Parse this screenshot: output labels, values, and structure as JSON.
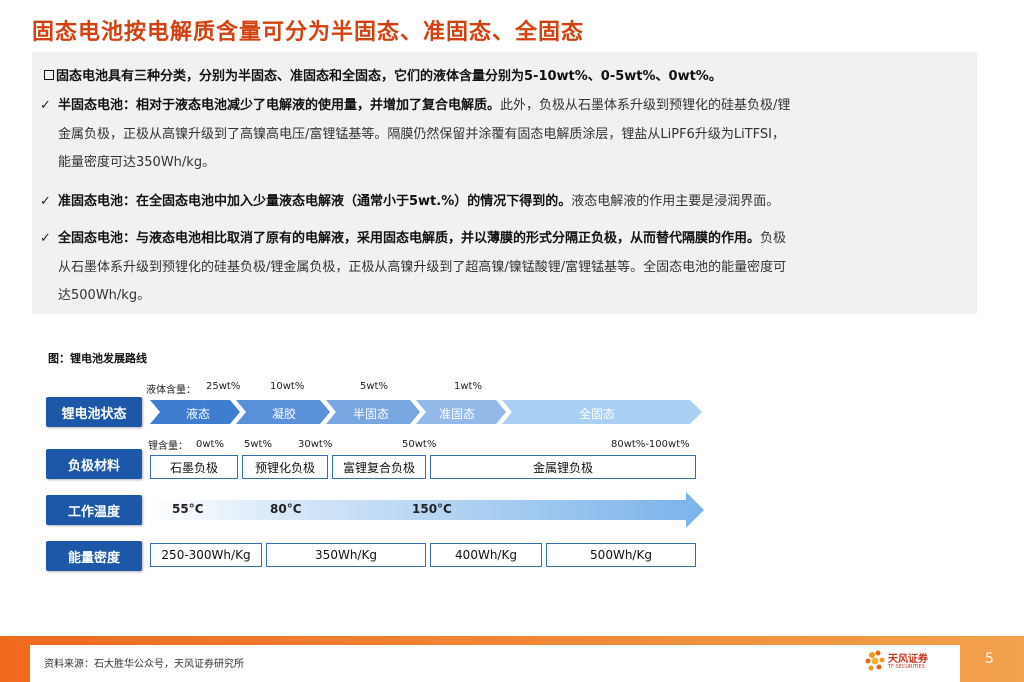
{
  "title": "固态电池按电解质含量可分为半固态、准固态、全固态",
  "summary": {
    "head": "固态电池具有三种分类，分别为半固态、准固态和全固态，它们的液体含量分别为5-10wt%、0-5wt%、0wt%。",
    "items": [
      {
        "check": "✓",
        "bold": "半固态电池：相对于液态电池减少了电解液的使用量，并增加了复合电解质。",
        "text1": "此外，负极从石墨体系升级到预锂化的硅基负极/锂",
        "text2": "金属负极，正极从高镍升级到了高镍高电压/富锂锰基等。隔膜仍然保留并涂覆有固态电解质涂层，锂盐从LiPF6升级为LiTFSI，",
        "text3": "能量密度可达350Wh/kg。"
      },
      {
        "check": "✓",
        "bold": "准固态电池：在全固态电池中加入少量液态电解液（通常小于5wt.%）的情况下得到的。",
        "text1": "液态电解液的作用主要是浸润界面。"
      },
      {
        "check": "✓",
        "bold": "全固态电池：与液态电池相比取消了原有的电解液，采用固态电解质，并以薄膜的形式分隔正负极，从而替代隔膜的作用。",
        "text1": "负极",
        "text2": "从石墨体系升级到预锂化的硅基负极/锂金属负极，正极从高镍升级到了超高镍/镍锰酸锂/富锂锰基等。全固态电池的能量密度可",
        "text3": "达500Wh/kg。"
      }
    ]
  },
  "figure": {
    "caption": "图：锂电池发展路线",
    "rows": {
      "state": {
        "label": "锂电池状态",
        "liquid_content_label": "液体含量：",
        "liquid_values": [
          "25wt%",
          "10wt%",
          "5wt%",
          "1wt%"
        ],
        "stages": [
          "液态",
          "凝胶",
          "半固态",
          "准固态",
          "全固态"
        ]
      },
      "anode": {
        "label": "负极材料",
        "li_content_label": "锂含量：",
        "li_values": [
          "0wt%",
          "5wt%",
          "30wt%",
          "50wt%",
          "80wt%-100wt%"
        ],
        "cells": [
          "石墨负极",
          "预锂化负极",
          "富锂复合负极",
          "金属锂负极"
        ]
      },
      "temp": {
        "label": "工作温度",
        "values": [
          "55°C",
          "80°C",
          "150°C"
        ]
      },
      "energy": {
        "label": "能量密度",
        "cells": [
          "250-300Wh/Kg",
          "350Wh/Kg",
          "400Wh/Kg",
          "500Wh/Kg"
        ]
      }
    }
  },
  "footer": {
    "source": "资料来源：石大胜华公众号，天风证券研究所",
    "logo_text": "天风证券",
    "logo_sub": "TF SECURITIES",
    "page": "5"
  },
  "colors": {
    "title": "#d2410f",
    "row_label_bg": "#1d57a8",
    "chevron_dark": "#3f7dd0",
    "chevron_light": "#a9cff3",
    "footer_orange": "#f06a1e"
  }
}
